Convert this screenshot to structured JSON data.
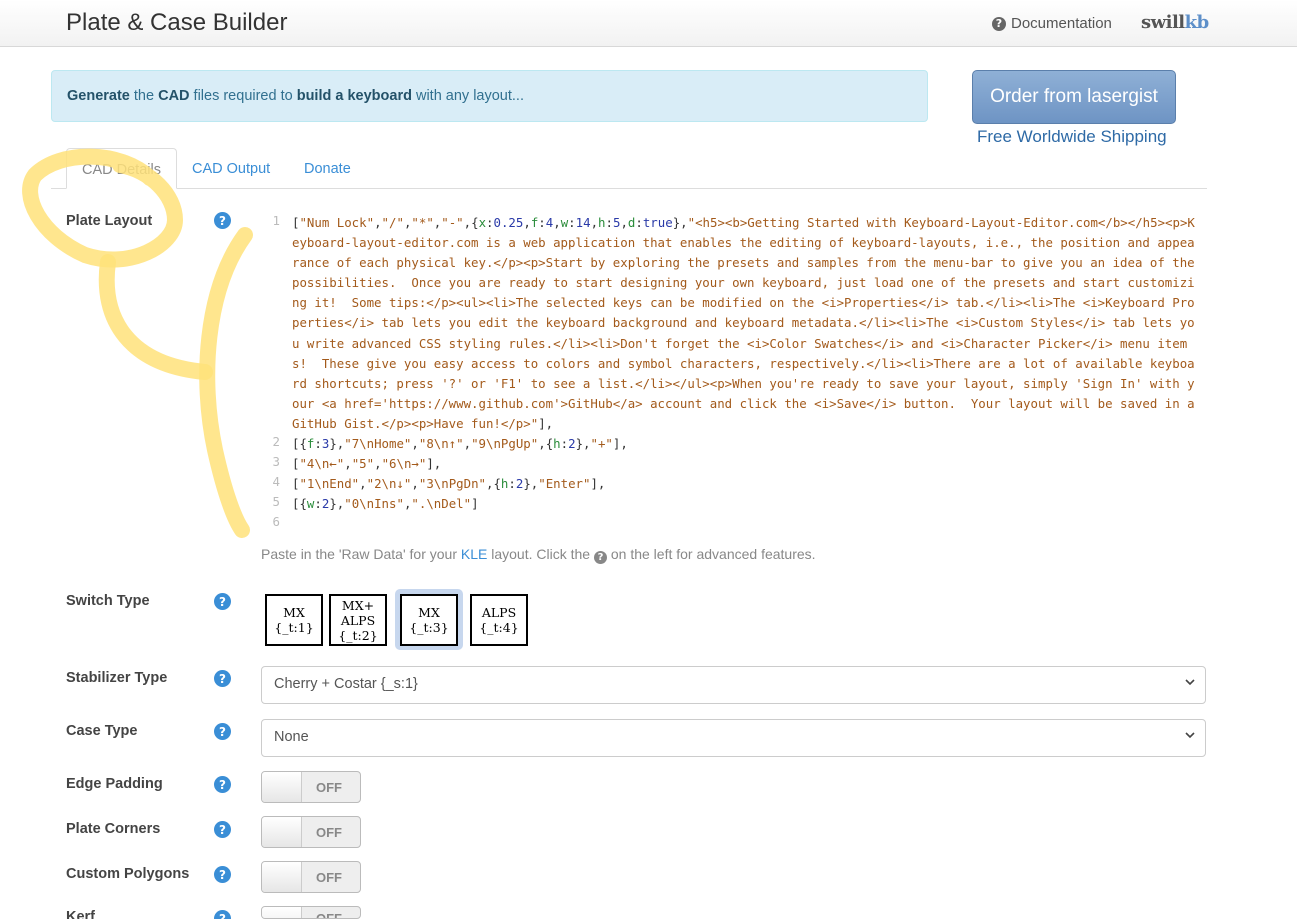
{
  "navbar": {
    "title": "Plate & Case Builder",
    "documentation": "Documentation",
    "logo_part1": "swill",
    "logo_part2": "kb"
  },
  "banner": {
    "w1": "Generate",
    "t1": " the ",
    "w2": "CAD",
    "t2": " files required to ",
    "w3": "build a keyboard",
    "t3": " with any layout..."
  },
  "order": {
    "button": "Order from lasergist",
    "shipping": "Free Worldwide Shipping"
  },
  "tabs": [
    {
      "label": "CAD Details"
    },
    {
      "label": "CAD Output"
    },
    {
      "label": "Donate"
    }
  ],
  "plate_layout": {
    "label": "Plate Layout",
    "lines": [
      {
        "num": "1",
        "text": "[\"Num Lock\",\"/\",\"*\",\"-\",{x:0.25,f:4,w:14,h:5,d:true},\"<h5><b>Getting Started with Keyboard-Layout-Editor.com</b></h5><p>Keyboard-layout-editor.com is a web application that enables the editing of keyboard-layouts, i.e., the position and appearance of each physical key.</p><p>Start by exploring the presets and samples from the menu-bar to give you an idea of the possibilities.  Once you are ready to start designing your own keyboard, just load one of the presets and start customizing it!  Some tips:</p><ul><li>The selected keys can be modified on the <i>Properties</i> tab.</li><li>The <i>Keyboard Properties</i> tab lets you edit the keyboard background and keyboard metadata.</li><li>The <i>Custom Styles</i> tab lets you write advanced CSS styling rules.</li><li>Don't forget the <i>Color Swatches</i> and <i>Character Picker</i> menu items!  These give you easy access to colors and symbol characters, respectively.</li><li>There are a lot of available keyboard shortcuts; press '?' or 'F1' to see a list.</li></ul><p>When you're ready to save your layout, simply 'Sign In' with your <a href='https://www.github.com'>GitHub</a> account and click the <i>Save</i> button.  Your layout will be saved in a GitHub Gist.</p><p>Have fun!</p>\"],"
      },
      {
        "num": "2",
        "text": "[{f:3},\"7\\nHome\",\"8\\n↑\",\"9\\nPgUp\",{h:2},\"+\"],"
      },
      {
        "num": "3",
        "text": "[\"4\\n←\",\"5\",\"6\\n→\"],"
      },
      {
        "num": "4",
        "text": "[\"1\\nEnd\",\"2\\n↓\",\"3\\nPgDn\",{h:2},\"Enter\"],"
      },
      {
        "num": "5",
        "text": "[{w:2},\"0\\nIns\",\".\\nDel\"]"
      },
      {
        "num": "6",
        "text": ""
      }
    ],
    "hint_before": "Paste in the 'Raw Data' for your ",
    "hint_link": "KLE",
    "hint_middle": " layout. Click the ",
    "hint_after": " on the left for advanced features."
  },
  "switch_type": {
    "label": "Switch Type",
    "options": [
      {
        "line1": "MX",
        "line2": "{_t:1}"
      },
      {
        "line1": "MX+",
        "line2": "ALPS",
        "line3": "{_t:2}"
      },
      {
        "line1": "MX",
        "line2": "{_t:3}",
        "selected": true
      },
      {
        "line1": "ALPS",
        "line2": "{_t:4}"
      }
    ]
  },
  "stabilizer_type": {
    "label": "Stabilizer Type",
    "value": "Cherry + Costar {_s:1}"
  },
  "case_type": {
    "label": "Case Type",
    "value": "None"
  },
  "edge_padding": {
    "label": "Edge Padding",
    "state": "OFF"
  },
  "plate_corners": {
    "label": "Plate Corners",
    "state": "OFF"
  },
  "custom_polygons": {
    "label": "Custom Polygons",
    "state": "OFF"
  },
  "kerf": {
    "label": "Kerf",
    "state": "OFF"
  },
  "colors": {
    "accent": "#3a8ed6",
    "banner_bg": "#d9edf7",
    "selected_switch": "#c7d7ee",
    "scribble": "#ffe27a"
  },
  "icons": [
    "question-circle-icon",
    "chevron-down-icon"
  ]
}
